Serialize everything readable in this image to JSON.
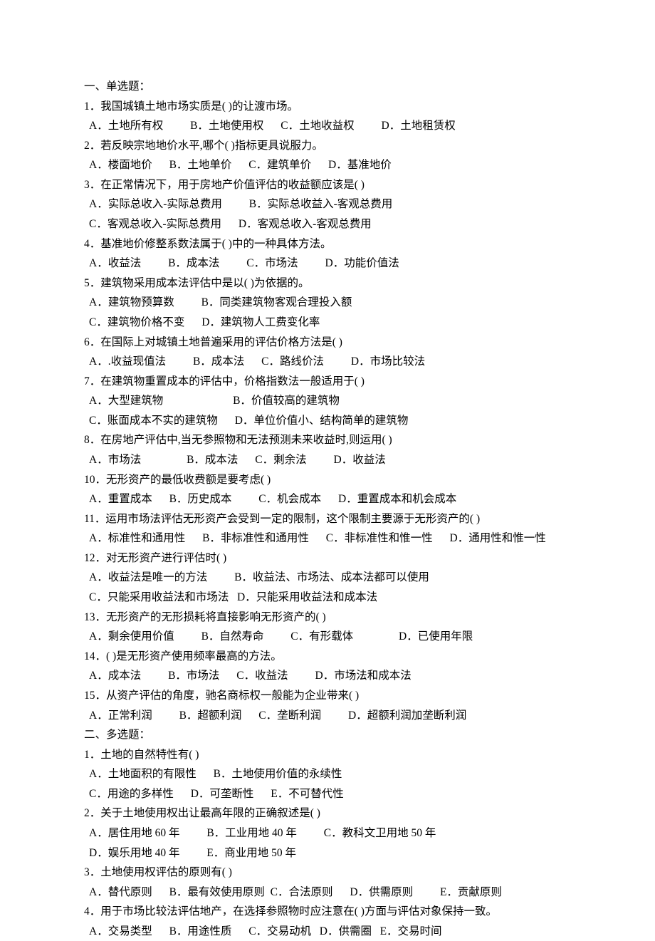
{
  "sections": {
    "s1": "一、单选题：",
    "s2": "二、多选题："
  },
  "single": {
    "q1": {
      "stem": "1．我国城镇土地市场实质是(    )的让渡市场。",
      "a": "A．土地所有权",
      "b": "B．土地使用权",
      "c": "C．土地收益权",
      "d": "D．土地租赁权"
    },
    "q2": {
      "stem": "2．若反映宗地地价水平,哪个(    )指标更具说服力。",
      "a": "A．楼面地价",
      "b": "B．土地单价",
      "c": "C．建筑单价",
      "d": "D．基准地价"
    },
    "q3": {
      "stem": "3．在正常情况下，用于房地产价值评估的收益额应该是(    )",
      "a": "A．实际总收入-实际总费用",
      "b": "B．实际总收益入-客观总费用",
      "c": "C．客观总收入-实际总费用",
      "d": "D．客观总收入-客观总费用"
    },
    "q4": {
      "stem": "4．基准地价修整系数法属于(    )中的一种具体方法。",
      "a": "A．收益法",
      "b": "B．成本法",
      "c": "C．市场法",
      "d": "D．功能价值法"
    },
    "q5": {
      "stem": "5．建筑物采用成本法评估中是以(    )为依据的。",
      "a": "A．建筑物预算数",
      "b": "B．同类建筑物客观合理投入额",
      "c": "C．建筑物价格不变",
      "d": "D．建筑物人工费变化率"
    },
    "q6": {
      "stem": "6．在国际上对城镇土地普遍采用的评估价格方法是(    )",
      "a": "A．.收益现值法",
      "b": "B．成本法",
      "c": "C．路线价法",
      "d": "D．市场比较法"
    },
    "q7": {
      "stem": "7．在建筑物重置成本的评估中，价格指数法一般适用于(    )",
      "a": "A．大型建筑物",
      "b": "B．价值较高的建筑物",
      "c": "C．账面成本不实的建筑物",
      "d": "D．单位价值小、结构简单的建筑物"
    },
    "q8": {
      "stem": "8．在房地产评估中,当无参照物和无法预测未来收益时,则运用(    )",
      "a": "A．市场法",
      "b": "B．成本法",
      "c": "C．剩余法",
      "d": "D．收益法"
    },
    "q10": {
      "stem": "10．无形资产的最低收费额是要考虑(    )",
      "a": "A．重置成本",
      "b": "B．历史成本",
      "c": "C．机会成本",
      "d": "D．重置成本和机会成本"
    },
    "q11": {
      "stem": "11．运用市场法评估无形资产会受到一定的限制，这个限制主要源于无形资产的(    )",
      "a": "A．标准性和通用性",
      "b": "B．非标准性和通用性",
      "c": "C．非标准性和惟一性",
      "d": "D．通用性和惟一性"
    },
    "q12": {
      "stem": "12．对无形资产进行评估时(    )",
      "a": "A．收益法是唯一的方法",
      "b": "B．收益法、市场法、成本法都可以使用",
      "c": "C．只能采用收益法和市场法",
      "d": "D．只能采用收益法和成本法"
    },
    "q13": {
      "stem": "13．无形资产的无形损耗将直接影响无形资产的(    )",
      "a": "A．剩余使用价值",
      "b": "B．自然寿命",
      "c": "C．有形载体",
      "d": "D．已使用年限"
    },
    "q14": {
      "stem": "14．(    )是无形资产使用频率最高的方法。",
      "a": "A．成本法",
      "b": "B．市场法",
      "c": "C．收益法",
      "d": "D．市场法和成本法"
    },
    "q15": {
      "stem": "15．从资产评估的角度，驰名商标权一般能为企业带来(    )",
      "a": "A．正常利润",
      "b": "B．超额利润",
      "c": "C．垄断利润",
      "d": "D．超额利润加垄断利润"
    }
  },
  "multi": {
    "q1": {
      "stem": "1．土地的自然特性有(     )",
      "a": "A．土地面积的有限性",
      "b": "B．土地使用价值的永续性",
      "c": "C．用途的多样性",
      "d": "D．可垄断性",
      "e": "E．不可替代性"
    },
    "q2": {
      "stem": "2．关于土地使用权出让最高年限的正确叙述是(    )",
      "a": "A．居住用地 60 年",
      "b": "B．工业用地 40 年",
      "c": "C．教科文卫用地 50 年",
      "d": "D．娱乐用地 40 年",
      "e": "E．商业用地 50 年"
    },
    "q3": {
      "stem": "3．土地使用权评估的原则有(    )",
      "a": "A．替代原则",
      "b": "B．最有效使用原则",
      "c": "C．合法原则",
      "d": "D．供需原则",
      "e": "E．贡献原则"
    },
    "q4": {
      "stem": "4．用于市场比较法评估地产，在选择参照物时应注意在(    )方面与评估对象保持一致。",
      "a": "A．交易类型",
      "b": "B．用途性质",
      "c": "C．交易动机",
      "d": "D．供需圈",
      "e": "E．交易时间"
    }
  }
}
